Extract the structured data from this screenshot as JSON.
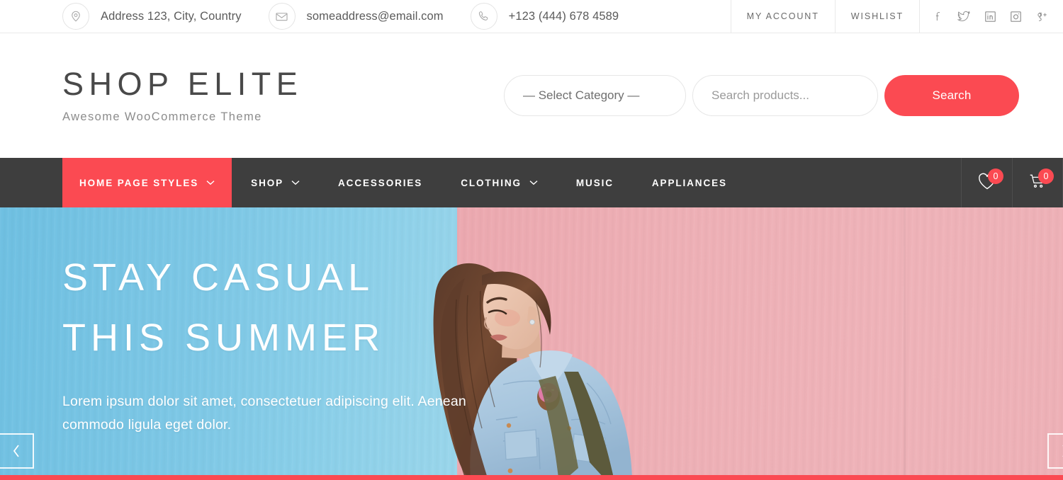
{
  "topbar": {
    "address": "Address 123, City, Country",
    "email": "someaddress@email.com",
    "phone": "+123 (444) 678 4589",
    "my_account": "MY ACCOUNT",
    "wishlist": "WISHLIST",
    "socials": [
      "facebook-icon",
      "twitter-icon",
      "linkedin-icon",
      "instagram-icon",
      "googleplus-icon"
    ]
  },
  "header": {
    "brand_title": "SHOP ELITE",
    "brand_tagline": "Awesome WooCommerce Theme",
    "category_value": "— Select Category —",
    "search_placeholder": "Search products...",
    "search_value": "",
    "search_button": "Search"
  },
  "nav": {
    "items": [
      {
        "label": "HOME PAGE STYLES",
        "has_dropdown": true,
        "active": true
      },
      {
        "label": "SHOP",
        "has_dropdown": true,
        "active": false
      },
      {
        "label": "ACCESSORIES",
        "has_dropdown": false,
        "active": false
      },
      {
        "label": "CLOTHING",
        "has_dropdown": true,
        "active": false
      },
      {
        "label": "MUSIC",
        "has_dropdown": false,
        "active": false
      },
      {
        "label": "APPLIANCES",
        "has_dropdown": false,
        "active": false
      }
    ],
    "wishlist_count": "0",
    "cart_count": "0"
  },
  "hero": {
    "title": "STAY CASUAL THIS SUMMER",
    "subtitle": "Lorem ipsum dolor sit amet, consectetuer adipiscing elit. Aenean commodo ligula eget dolor.",
    "prev_label": "‹",
    "next_label": "›"
  },
  "colors": {
    "accent": "#fb4a52",
    "nav_bg": "#3e3e3e",
    "wall_blue": "#76c4e4",
    "wall_pink": "#eeb1b7",
    "text_dark": "#494949"
  }
}
